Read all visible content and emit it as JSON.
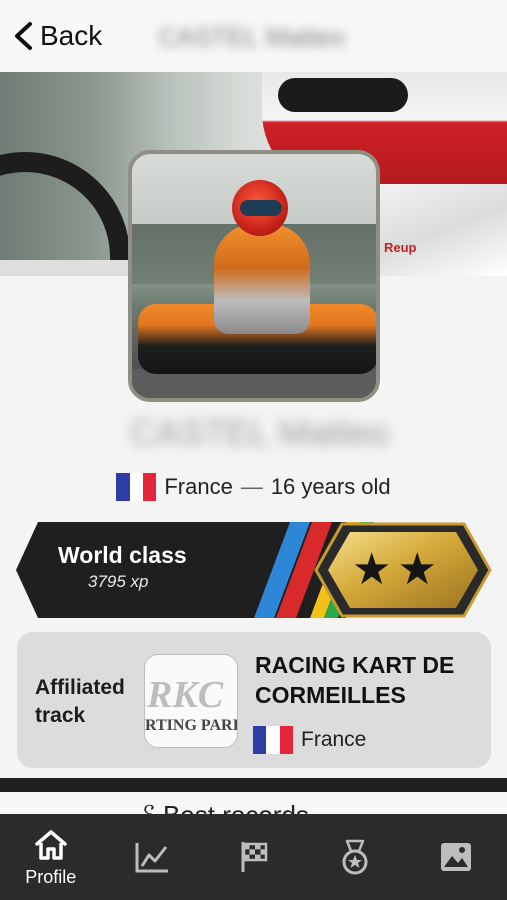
{
  "header": {
    "back_label": "Back",
    "title": "CASTEL Matteo"
  },
  "profile": {
    "name": "CASTEL Matteo",
    "country": "France",
    "age": "16 years old",
    "separator": "—"
  },
  "rank": {
    "title": "World class",
    "xp": "3795 xp",
    "stars": "★★",
    "colors": {
      "badge_gold": "#d4a93a",
      "stripe_blue": "#2d86d6",
      "stripe_red": "#d82a2a",
      "stripe_yellow": "#f2c21b",
      "stripe_green": "#2aa84a"
    }
  },
  "affiliated": {
    "label": "Affiliated track",
    "track_name": "RACING KART DE CORMEILLES",
    "country": "France",
    "logo_text": "RKC",
    "logo_subtext": "RTING PARI"
  },
  "peek_text": "ℰ Best records",
  "tabs": [
    {
      "icon": "home-icon",
      "label": "Profile",
      "active": true
    },
    {
      "icon": "chart-icon",
      "label": "",
      "active": false
    },
    {
      "icon": "checkered-flag-icon",
      "label": "",
      "active": false
    },
    {
      "icon": "medal-icon",
      "label": "",
      "active": false
    },
    {
      "icon": "image-icon",
      "label": "",
      "active": false
    }
  ]
}
